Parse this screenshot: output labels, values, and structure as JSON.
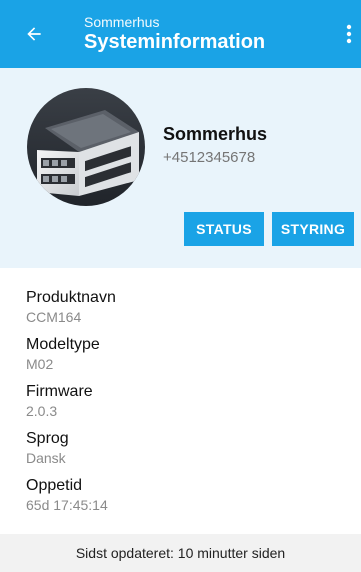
{
  "appbar": {
    "subtitle": "Sommerhus",
    "title": "Systeminformation",
    "back_icon": "arrow-left-icon",
    "menu_icon": "more-vert-icon"
  },
  "device": {
    "name": "Sommerhus",
    "phone": "+4512345678"
  },
  "buttons": {
    "status_label": "STATUS",
    "styring_label": "STYRING"
  },
  "info": {
    "items": [
      {
        "label": "Produktnavn",
        "value": "CCM164"
      },
      {
        "label": "Modeltype",
        "value": "M02"
      },
      {
        "label": "Firmware",
        "value": "2.0.3"
      },
      {
        "label": "Sprog",
        "value": "Dansk"
      },
      {
        "label": "Oppetid",
        "value": "65d 17:45:14"
      }
    ]
  },
  "footer": {
    "text": "Sidst opdateret: 10 minutter siden"
  },
  "colors": {
    "accent": "#1aa3e6",
    "panel": "#e9f4fb"
  }
}
